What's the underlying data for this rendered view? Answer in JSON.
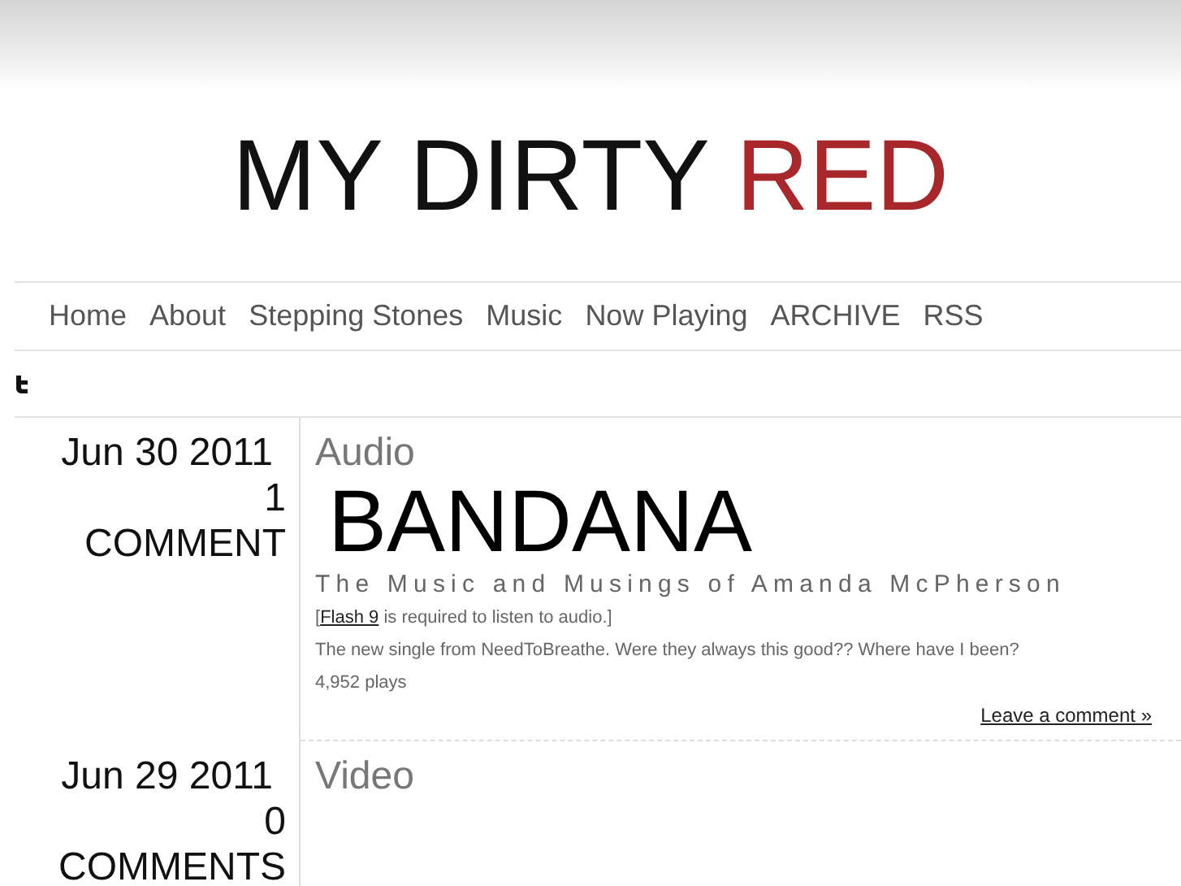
{
  "site_title": [
    {
      "text": "MY DIRTY",
      "accent": false
    },
    {
      "text": "RED",
      "accent": true
    }
  ],
  "nav": [
    "Home",
    "About",
    "Stepping Stones",
    "Music",
    "Now Playing",
    "ARCHIVE",
    "RSS"
  ],
  "overlay": {
    "title": "BANDANA",
    "tagline": "The Music and Musings of Amanda McPherson"
  },
  "posts": [
    {
      "date": "Jun 30 2011",
      "comment_count": "1",
      "comment_label": "COMMENT",
      "title": "Audio",
      "paragraphs": [
        {
          "before": "[",
          "link": "Flash 9",
          "after": " is required to listen to audio.]"
        },
        {
          "text": "The new single from NeedToBreathe. Were they always this good?? Where have I been?"
        }
      ],
      "plays": "4,952 plays",
      "leave_comment": "Leave a comment »"
    },
    {
      "date": "Jun 29 2011",
      "comment_count": "0",
      "comment_label": "COMMENTS",
      "title": "Video"
    }
  ]
}
